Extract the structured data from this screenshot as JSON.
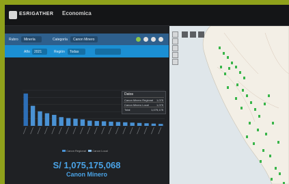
{
  "header": {
    "logo_text": "ESRIGATHER",
    "app_title": "Economica"
  },
  "filters": {
    "row1": [
      "Rubro",
      "Minería",
      "Categoría",
      "Canon Minero"
    ],
    "row2": [
      "Año",
      "2021",
      "Región",
      "Todas"
    ]
  },
  "table": {
    "title": "Datos",
    "rows": [
      [
        "Canon Minero Regional",
        "1,075"
      ],
      [
        "Canon Minero Local",
        "1,075"
      ],
      [
        "Total",
        "1,075,175"
      ]
    ]
  },
  "chart_data": {
    "type": "bar",
    "title": "",
    "ylabel": "",
    "xlabel": "",
    "categories": [
      "",
      "",
      "",
      "",
      "",
      "",
      "",
      "",
      "",
      "",
      "",
      "",
      "",
      "",
      "",
      "",
      "",
      "",
      "",
      ""
    ],
    "values": [
      100,
      62,
      45,
      39,
      34,
      27,
      24,
      22,
      20,
      16,
      15,
      14,
      13,
      12,
      11,
      10,
      9,
      8,
      7,
      6
    ],
    "ylim": [
      0,
      110
    ],
    "grid": true,
    "colors": {
      "bar": "#4a92d4",
      "first_bar": "#2d6fb8"
    }
  },
  "summary": {
    "amount": "S/ 1,075,175,068",
    "label": "Canon Minero",
    "legend": [
      "Canon Regional",
      "Canon Local"
    ]
  },
  "colors": {
    "accent": "#4aa3e6",
    "panel_dark": "#1f2124",
    "filter_blue": "#1b8fd3",
    "map_land": "#f3efe6",
    "marker_green": "#39b54a"
  },
  "map": {
    "marker_color": "#39b54a"
  }
}
